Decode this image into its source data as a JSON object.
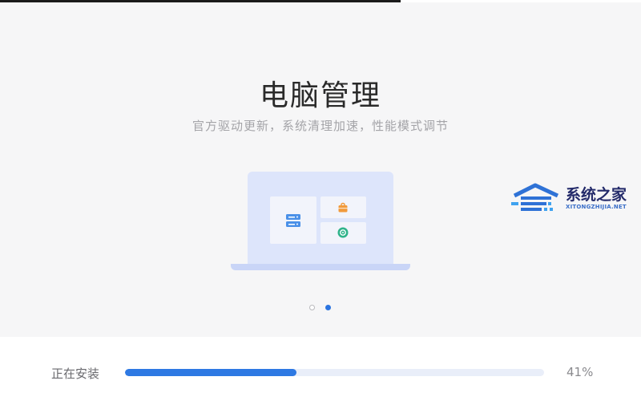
{
  "hero": {
    "title": "电脑管理",
    "subtitle": "官方驱动更新，系统清理加速，性能模式调节"
  },
  "illustration": {
    "icons": [
      "server-icon",
      "bag-icon",
      "refresh-icon"
    ]
  },
  "carousel": {
    "total_dots": 2,
    "active_index": 1
  },
  "watermark": {
    "text": "系统之家",
    "subtext": "XITONGZHIJIA.NET"
  },
  "install": {
    "status_label": "正在安装",
    "progress_fraction": 0.41,
    "percent_text": "41%"
  },
  "colors": {
    "accent": "#2e79e3",
    "track": "#e9eef9",
    "hero_bg": "#f6f6f7"
  }
}
